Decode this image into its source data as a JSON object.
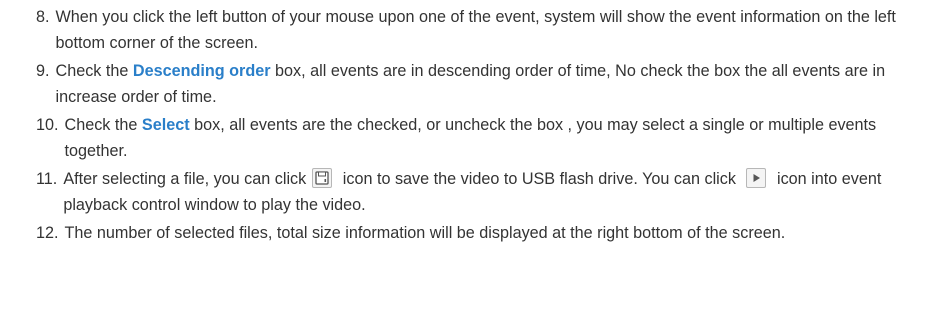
{
  "steps": [
    {
      "number": "8.",
      "text": "When you click the left button of your mouse upon one of the event, system will show the event information on the left bottom corner of the screen."
    },
    {
      "number": "9.",
      "before": "Check the ",
      "keyword": "Descending order",
      "after": " box, all events are in descending order of time, No check the box the all events are in increase order of time."
    },
    {
      "number": "10.",
      "before": "Check the ",
      "keyword": "Select",
      "after": " box, all events are the checked, or uncheck the box , you may select a single or multiple events together."
    },
    {
      "number": "11.",
      "part1": "After selecting a file, you can click",
      "part2": "icon to save the video to USB flash drive. You can click",
      "part3": "icon into event playback control window to play the video.",
      "icons": [
        "save-icon",
        "play-icon"
      ]
    },
    {
      "number": "12.",
      "text": "The number of selected files, total size information will be displayed at the right bottom of the screen."
    }
  ],
  "colors": {
    "text": "#333333",
    "keyword": "#2a7fc9"
  }
}
